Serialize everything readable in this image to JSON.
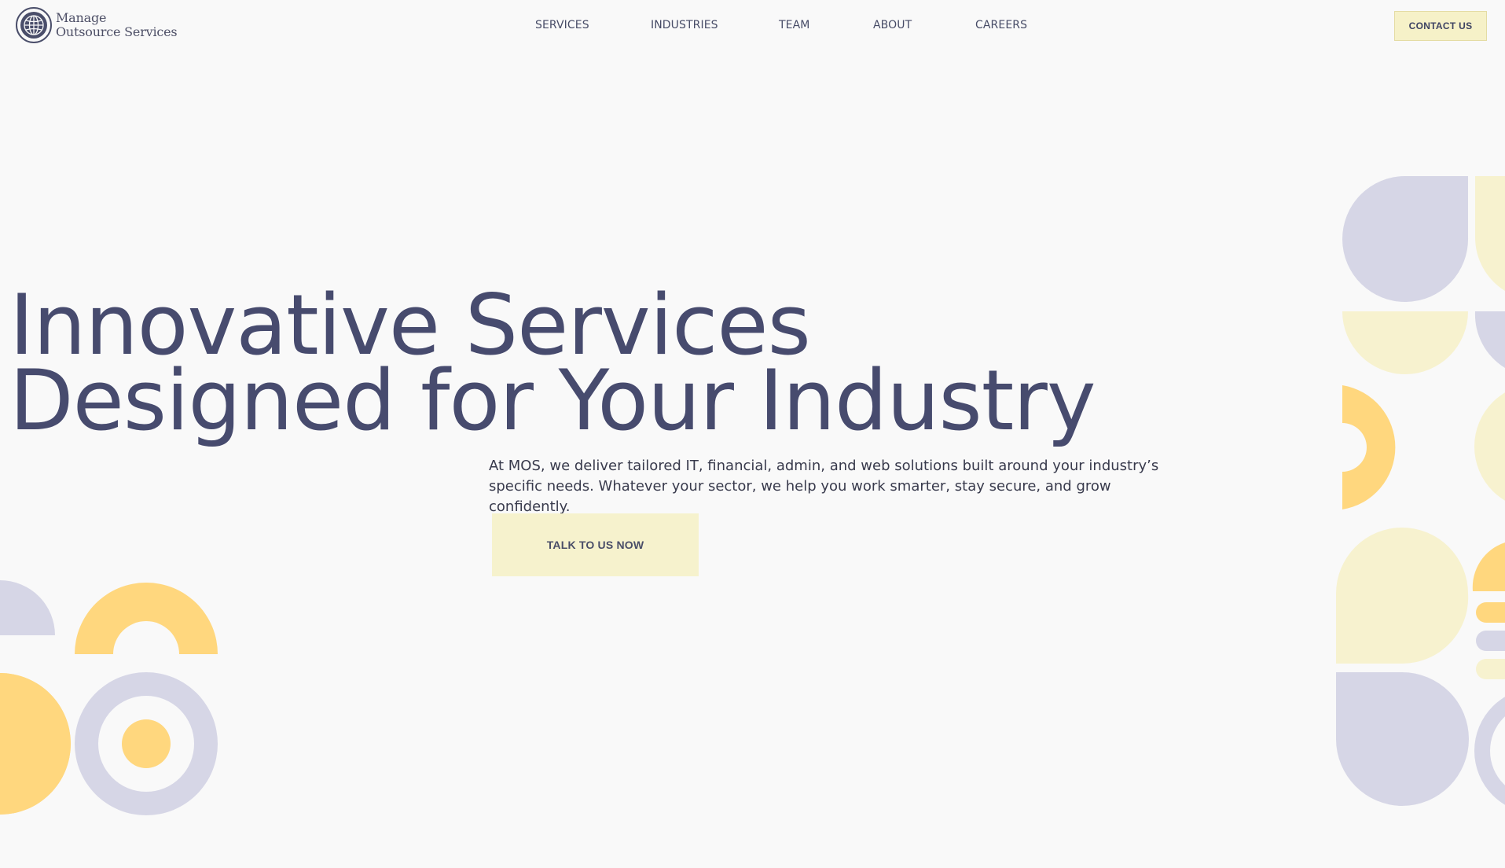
{
  "colors": {
    "primary_text": "#474b6e",
    "lavender": "#d6d6e6",
    "pale_yellow": "#f7f2cf",
    "golden": "#ffd77e",
    "background": "#f9f9f9",
    "button_bg": "#f6f1c8"
  },
  "header": {
    "logo": {
      "icon": "globe-icon",
      "line1": "Manage",
      "line2": "Outsource Services"
    },
    "nav": [
      {
        "label": "SERVICES"
      },
      {
        "label": "INDUSTRIES"
      },
      {
        "label": "TEAM"
      },
      {
        "label": "ABOUT"
      },
      {
        "label": "CAREERS"
      }
    ],
    "contact_label": "CONTACT US"
  },
  "hero": {
    "title_line1": "Innovative Services",
    "title_line2": "Designed for Your Industry",
    "description": "At MOS, we deliver tailored IT, financial, admin, and web solutions built around your industry’s specific needs. Whatever your sector, we help you work smarter, stay secure, and grow confidently.",
    "cta_label": "TALK TO US NOW"
  }
}
